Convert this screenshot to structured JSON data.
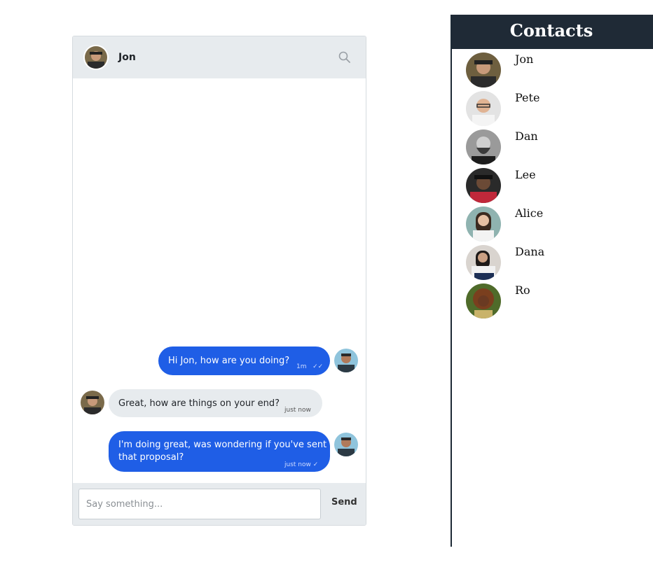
{
  "chat": {
    "contact_name": "Jon",
    "search_icon": "search-icon",
    "messages": [
      {
        "direction": "outgoing",
        "text": "Hi Jon, how are you doing?",
        "time": "1m",
        "status": "✓✓"
      },
      {
        "direction": "incoming",
        "text": "Great, how are things on your end?",
        "time": "just now"
      },
      {
        "direction": "outgoing",
        "text": "I'm doing great, was wondering if you've sent",
        "text_line2": "that proposal?",
        "time": "just now",
        "status": "✓"
      }
    ],
    "composer": {
      "placeholder": "Say something...",
      "value": "",
      "send_label": "Send"
    }
  },
  "contacts": {
    "title": "Contacts",
    "items": [
      {
        "name": "Jon"
      },
      {
        "name": "Pete"
      },
      {
        "name": "Dan"
      },
      {
        "name": "Lee"
      },
      {
        "name": "Alice"
      },
      {
        "name": "Dana"
      },
      {
        "name": "Ro"
      }
    ]
  },
  "colors": {
    "accent": "#1f5ee6",
    "header_bg": "#e7ebee",
    "contacts_header_bg": "#1f2a36"
  }
}
